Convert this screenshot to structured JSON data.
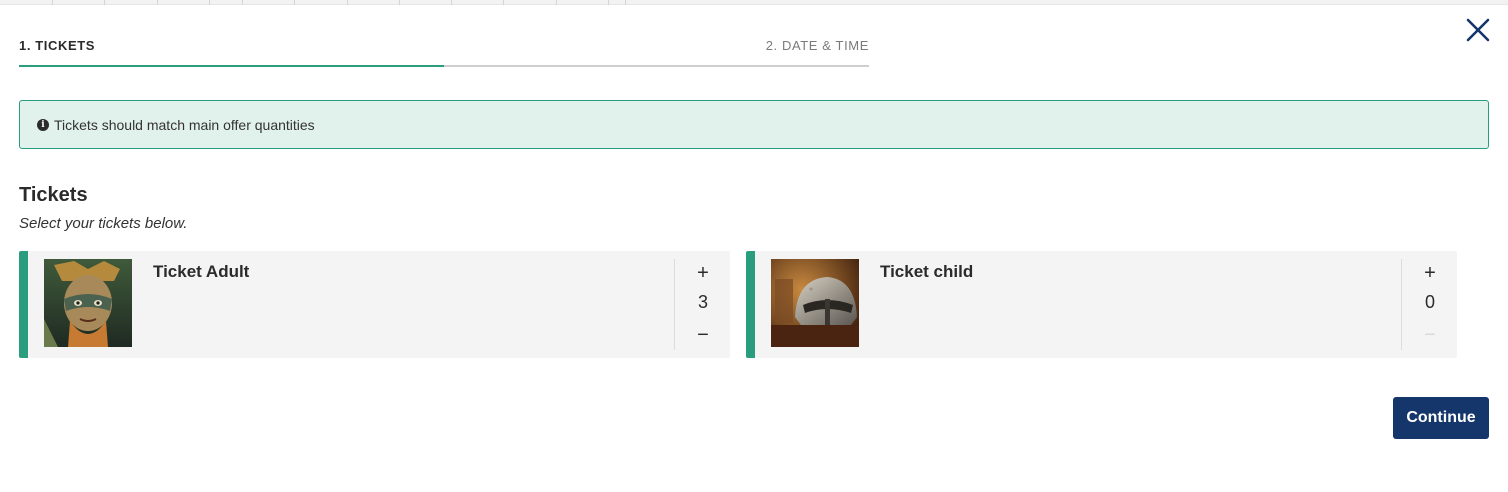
{
  "steps": [
    {
      "label": "1. TICKETS",
      "active": true
    },
    {
      "label": "2. DATE & TIME",
      "active": false
    }
  ],
  "step_progress": 0.5,
  "alert": {
    "icon": "info-icon",
    "text": "Tickets should match main offer quantities"
  },
  "section": {
    "title": "Tickets",
    "subtitle": "Select your tickets below."
  },
  "tickets": [
    {
      "name": "Ticket Adult",
      "quantity": "3",
      "image": "viking-warrior-image"
    },
    {
      "name": "Ticket child",
      "quantity": "0",
      "image": "viking-helmet-image"
    }
  ],
  "qty_controls": {
    "plus": "+",
    "minus": "−"
  },
  "continue_label": "Continue",
  "colors": {
    "accent": "#2a9d7f",
    "primary": "#15366b",
    "alert_bg": "#e1f1ec",
    "card_bg": "#f4f4f4"
  }
}
